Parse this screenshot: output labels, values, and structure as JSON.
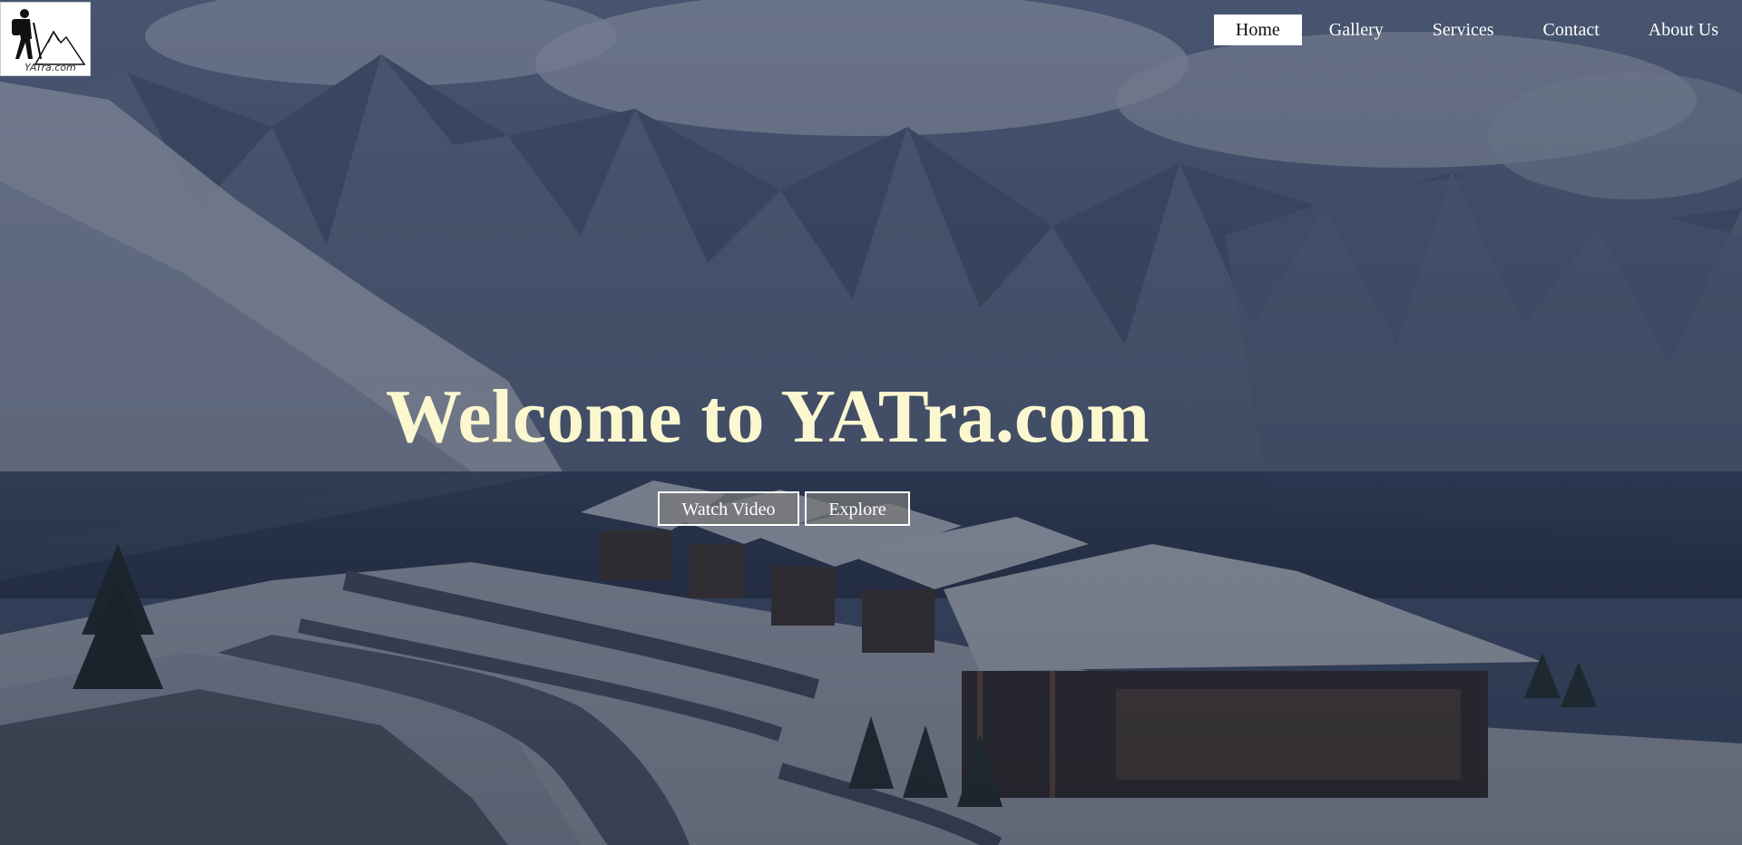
{
  "logo": {
    "text": "YATra.com",
    "icon": "hiker-mountain-logo"
  },
  "nav": {
    "items": [
      {
        "label": "Home",
        "active": true
      },
      {
        "label": "Gallery",
        "active": false
      },
      {
        "label": "Services",
        "active": false
      },
      {
        "label": "Contact",
        "active": false
      },
      {
        "label": "About Us",
        "active": false
      }
    ]
  },
  "hero": {
    "headline": "Welcome to YATra.com",
    "buttons": {
      "watch_video": "Watch Video",
      "explore": "Explore"
    },
    "image": "snowy-mountain-resort-photo"
  },
  "colors": {
    "headline": "#fbf7cf",
    "overlay": "#2b3a5a",
    "nav_active_bg": "#ffffff",
    "nav_text": "#ffffff"
  }
}
